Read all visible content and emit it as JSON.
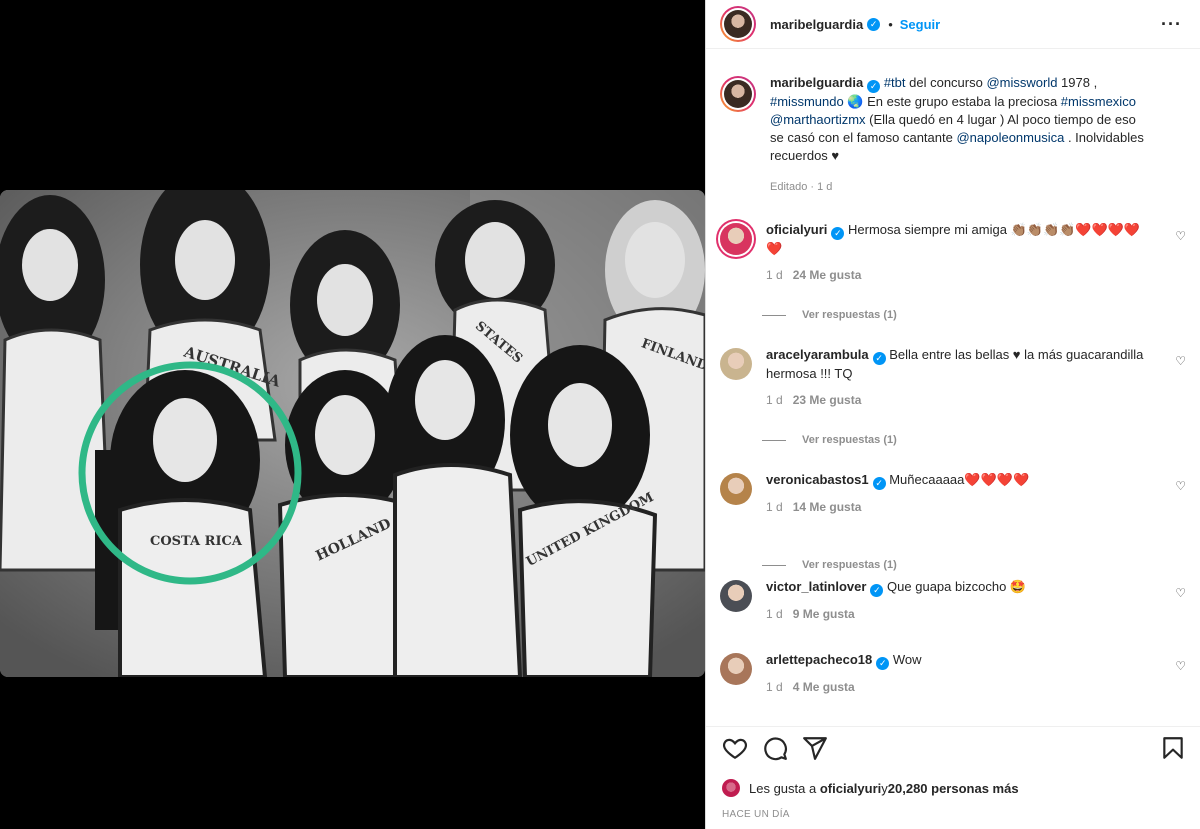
{
  "post": {
    "username": "maribelguardia",
    "follow_label": "Seguir",
    "dot": "•",
    "more_label": "···",
    "caption_parts": [
      {
        "t": "#tbt",
        "link": true
      },
      {
        "t": " del concurso ",
        "link": false
      },
      {
        "t": "@missworld",
        "link": true
      },
      {
        "t": " 1978 , ",
        "link": false
      },
      {
        "t": "#missmundo",
        "link": true
      },
      {
        "t": " 🌏 En este grupo estaba la preciosa ",
        "link": false
      },
      {
        "t": "#missmexico",
        "link": true
      },
      {
        "t": " ",
        "link": false
      },
      {
        "t": "@marthaortizmx",
        "link": true
      },
      {
        "t": " (Ella quedó en 4 lugar ) Al poco tiempo de eso se casó con el famoso cantante ",
        "link": false
      },
      {
        "t": "@napoleonmusica",
        "link": true
      },
      {
        "t": " . Inolvidables recuerdos ♥",
        "link": false
      }
    ],
    "edited": "Editado · 1 d"
  },
  "comments": [
    {
      "user": "oficialyuri",
      "text": "Hermosa siempre mi amiga 👏🏽👏🏽👏🏽👏🏽❤️❤️❤️❤️❤️",
      "age": "1 d",
      "likes": "24 Me gusta",
      "replies": "Ver respuestas (1)",
      "avatar_color": "#d8345f"
    },
    {
      "user": "aracelyarambula",
      "text": "Bella entre las bellas ♥ la más guacarandilla hermosa !!! TQ",
      "age": "1 d",
      "likes": "23 Me gusta",
      "replies": "Ver respuestas (1)",
      "avatar_color": "#c9b48f"
    },
    {
      "user": "veronicabastos1",
      "text": "Muñecaaaaa❤️❤️❤️❤️",
      "age": "1 d",
      "likes": "14 Me gusta",
      "replies": "Ver respuestas (1)",
      "avatar_color": "#b5834a"
    },
    {
      "user": "victor_latinlover",
      "text": "Que guapa bizcocho 🤩",
      "age": "1 d",
      "likes": "9 Me gusta",
      "replies": "",
      "avatar_color": "#4b4e55"
    },
    {
      "user": "arlettepacheco18",
      "text": "Wow",
      "age": "1 d",
      "likes": "4 Me gusta",
      "replies": "",
      "avatar_color": "#a8765a"
    }
  ],
  "likes_line": {
    "prefix": "Les gusta a ",
    "user": "oficialyuri",
    "middle": " y ",
    "count": "20,280 personas más"
  },
  "timestamp": "HACE UN DÍA",
  "icons": {
    "like": "heart-icon",
    "comment": "comment-icon",
    "share": "share-icon",
    "save": "bookmark-icon",
    "more": "more-options-icon"
  },
  "photo_shirt_texts": [
    "AUSTRALIA",
    "STATES",
    "FINLAND",
    "COSTA RICA",
    "HOLLAND",
    "UNITED KINGDOM"
  ],
  "colors": {
    "accent": "#0095f6",
    "circle": "#2fb887"
  }
}
